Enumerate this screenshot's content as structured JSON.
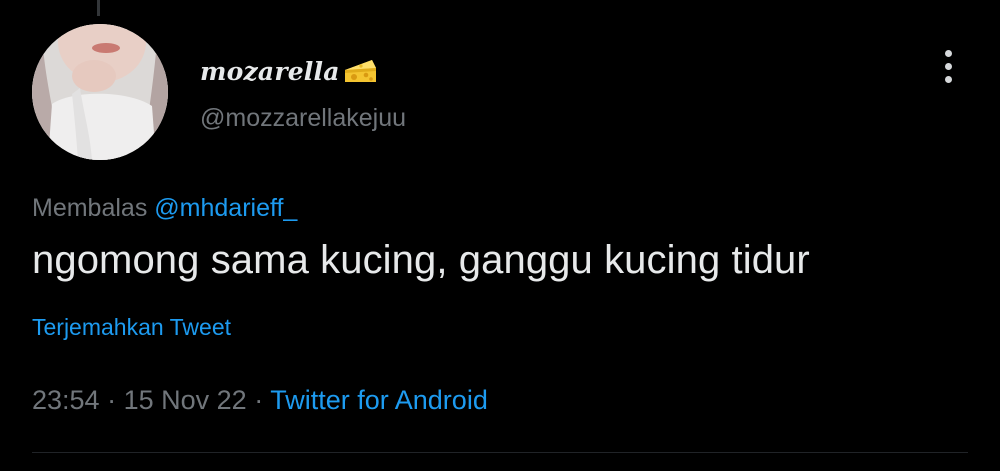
{
  "tweet": {
    "display_name": "mozarella",
    "name_emoji": "cheese-icon",
    "handle": "@mozzarellakejuu",
    "reply_prefix": "Membalas",
    "reply_to": "@mhdarieff_",
    "text": "ngomong sama kucing, ganggu kucing tidur",
    "translate_label": "Terjemahkan Tweet",
    "time": "23:54",
    "date": "15 Nov 22",
    "separator": "·",
    "source": "Twitter for Android"
  },
  "colors": {
    "background": "#000000",
    "text_primary": "#e7e9ea",
    "text_secondary": "#71767b",
    "accent": "#1d9bf0"
  }
}
